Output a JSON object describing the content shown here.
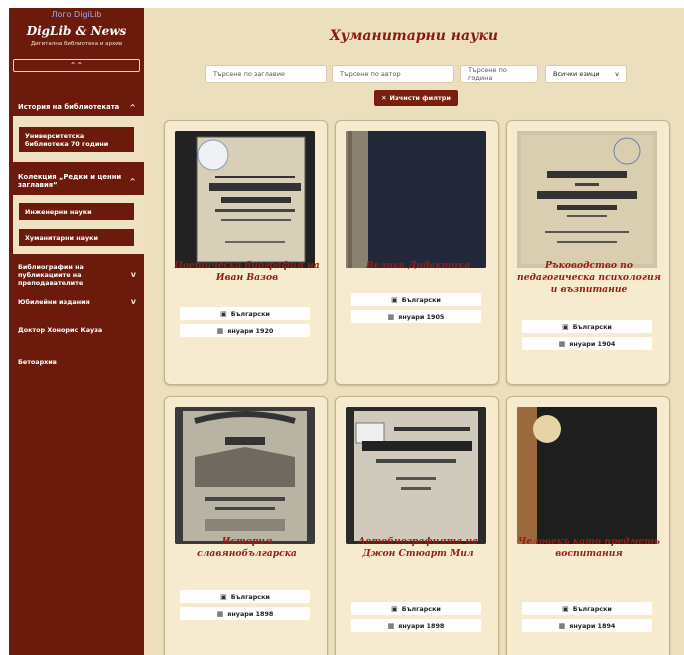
{
  "sidebar": {
    "logo_alt": "Лого DigiLib",
    "brand": "DigLib & News",
    "tagline": "Дигитална библиотека и архив",
    "collapse_icon": "⌃⌃",
    "sections": [
      {
        "label": "История на библиотеката",
        "chevron": "^",
        "items": [
          "Университетска библиотека 70 години"
        ]
      },
      {
        "label": "Колекция „Редки и ценни заглавия“",
        "chevron": "^",
        "items": [
          "Инженерни науки",
          "Хуманитарни науки"
        ]
      }
    ],
    "nav": [
      {
        "label": "Библиографии на публикациите на преподавателите",
        "chevron": "v"
      },
      {
        "label": "Юбилейни издания",
        "chevron": "v"
      },
      {
        "label": "Доктор Хонорис Кауза",
        "chevron": ""
      },
      {
        "label": "Бетоархив",
        "chevron": ""
      }
    ]
  },
  "main": {
    "title": "Хуманитарни науки",
    "filters": {
      "title_placeholder": "Търсене по заглавие",
      "author_placeholder": "Търсене по автор",
      "year_placeholder": "Търсене по година",
      "lang_selected": "Всички езици",
      "lang_chevron": "v"
    },
    "clear_button": {
      "icon": "✕",
      "label": "Изчисти филтри"
    },
    "lang_icon": "language-icon",
    "date_icon": "calendar-icon",
    "books": [
      {
        "title": "Поетическа биография на Иван Вазов",
        "language": "Български",
        "date": "януари 1920"
      },
      {
        "title": "Велика Дидактика",
        "language": "Български",
        "date": "януари 1905"
      },
      {
        "title": "Ръководство по педагогическа психология и възпитание",
        "language": "Български",
        "date": "януари 1904"
      },
      {
        "title": "История славянобългарска",
        "language": "Български",
        "date": "януари 1898"
      },
      {
        "title": "Автобиографията на Джон Стюарт Мил",
        "language": "Български",
        "date": "януари 1898"
      },
      {
        "title": "Человекъ като предметь воспитания",
        "language": "Български",
        "date": "януари 1894"
      }
    ]
  },
  "colors": {
    "sidebar": "#6b1a0c",
    "main_bg": "#ecdfbd",
    "accent_title": "#8b1a10",
    "card_bg": "#f6ebcf"
  }
}
